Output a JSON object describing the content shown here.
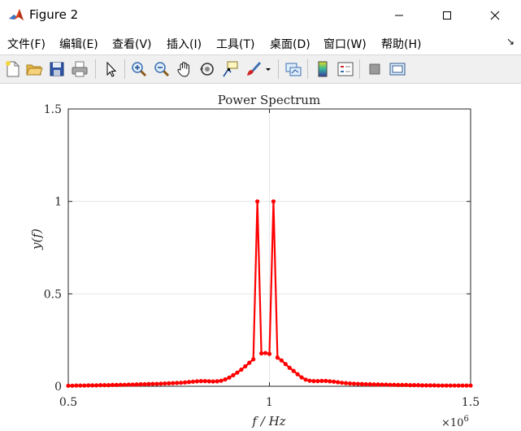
{
  "window": {
    "title": "Figure 2"
  },
  "menu": {
    "items": [
      {
        "label": "文件(F)",
        "name": "menu-file"
      },
      {
        "label": "编辑(E)",
        "name": "menu-edit"
      },
      {
        "label": "查看(V)",
        "name": "menu-view"
      },
      {
        "label": "插入(I)",
        "name": "menu-insert"
      },
      {
        "label": "工具(T)",
        "name": "menu-tools"
      },
      {
        "label": "桌面(D)",
        "name": "menu-desktop"
      },
      {
        "label": "窗口(W)",
        "name": "menu-window"
      },
      {
        "label": "帮助(H)",
        "name": "menu-help"
      }
    ]
  },
  "toolbar": {
    "icons": [
      "new-figure-icon",
      "open-file-icon",
      "save-icon",
      "print-icon",
      "select-arrow-icon",
      "zoom-in-icon",
      "zoom-out-icon",
      "pan-hand-icon",
      "rotate-3d-icon",
      "data-cursor-icon",
      "brush-icon",
      "brush-dropdown-icon",
      "link-plot-icon",
      "colorbar-icon",
      "legend-icon",
      "hide-plot-tools-icon",
      "show-plot-tools-icon"
    ]
  },
  "colors": {
    "series": "#ff0000",
    "grid": "#e6e6e6",
    "axis": "#262626"
  },
  "chart_data": {
    "type": "line",
    "title": "Power Spectrum",
    "xlabel": "f / Hz",
    "ylabel": "y(f)",
    "x_exponent_label": "×10",
    "x_exponent": "6",
    "xlim": [
      0.5,
      1.5
    ],
    "ylim": [
      0,
      1.5
    ],
    "x_scale_factor": 1000000,
    "xticks": [
      0.5,
      1,
      1.5
    ],
    "xtick_labels": [
      "0.5",
      "1",
      "1.5"
    ],
    "yticks": [
      0,
      0.5,
      1,
      1.5
    ],
    "ytick_labels": [
      "0",
      "0.5",
      "1",
      "1.5"
    ],
    "grid": true,
    "marker": "dot",
    "x": [
      0.5,
      0.51,
      0.52,
      0.53,
      0.54,
      0.55,
      0.56,
      0.57,
      0.58,
      0.59,
      0.6,
      0.61,
      0.62,
      0.63,
      0.64,
      0.65,
      0.66,
      0.67,
      0.68,
      0.69,
      0.7,
      0.71,
      0.72,
      0.73,
      0.74,
      0.75,
      0.76,
      0.77,
      0.78,
      0.79,
      0.8,
      0.81,
      0.82,
      0.83,
      0.84,
      0.85,
      0.86,
      0.87,
      0.88,
      0.89,
      0.9,
      0.91,
      0.92,
      0.93,
      0.94,
      0.95,
      0.96,
      0.97,
      0.98,
      0.99,
      1.0,
      1.01,
      1.02,
      1.03,
      1.04,
      1.05,
      1.06,
      1.07,
      1.08,
      1.09,
      1.1,
      1.11,
      1.12,
      1.13,
      1.14,
      1.15,
      1.16,
      1.17,
      1.18,
      1.19,
      1.2,
      1.21,
      1.22,
      1.23,
      1.24,
      1.25,
      1.26,
      1.27,
      1.28,
      1.29,
      1.3,
      1.31,
      1.32,
      1.33,
      1.34,
      1.35,
      1.36,
      1.37,
      1.38,
      1.39,
      1.4,
      1.41,
      1.42,
      1.43,
      1.44,
      1.45,
      1.46,
      1.47,
      1.48,
      1.49,
      1.5
    ],
    "y": [
      0.003,
      0.003,
      0.004,
      0.004,
      0.004,
      0.005,
      0.005,
      0.005,
      0.006,
      0.006,
      0.006,
      0.007,
      0.007,
      0.008,
      0.008,
      0.009,
      0.009,
      0.01,
      0.011,
      0.011,
      0.012,
      0.013,
      0.013,
      0.014,
      0.015,
      0.016,
      0.017,
      0.018,
      0.019,
      0.021,
      0.023,
      0.025,
      0.027,
      0.028,
      0.028,
      0.027,
      0.026,
      0.027,
      0.03,
      0.037,
      0.047,
      0.06,
      0.074,
      0.09,
      0.108,
      0.127,
      0.146,
      1.0,
      0.178,
      0.18,
      0.175,
      1.0,
      0.155,
      0.14,
      0.12,
      0.1,
      0.083,
      0.065,
      0.048,
      0.036,
      0.03,
      0.028,
      0.028,
      0.029,
      0.029,
      0.027,
      0.025,
      0.022,
      0.019,
      0.017,
      0.015,
      0.014,
      0.013,
      0.012,
      0.011,
      0.011,
      0.01,
      0.01,
      0.009,
      0.009,
      0.008,
      0.008,
      0.007,
      0.007,
      0.007,
      0.006,
      0.006,
      0.006,
      0.005,
      0.005,
      0.005,
      0.005,
      0.004,
      0.004,
      0.004,
      0.004,
      0.004,
      0.004,
      0.004,
      0.004,
      0.004
    ]
  }
}
